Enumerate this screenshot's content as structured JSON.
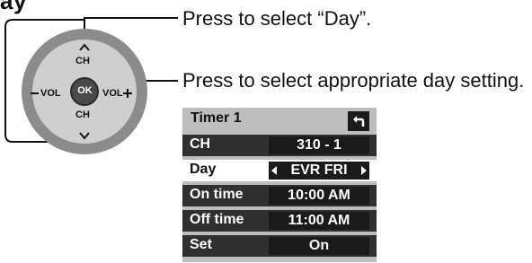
{
  "heading": "ay",
  "callouts": {
    "select_day": "Press to select “Day”.",
    "day_setting": "Press to select appropriate day setting."
  },
  "remote_pad": {
    "ch_up": "CH",
    "ch_down": "CH",
    "vol_minus": "VOL",
    "vol_plus": "VOL",
    "ok": "OK"
  },
  "menu": {
    "title": "Timer 1",
    "rows": [
      {
        "label": "CH",
        "value": "310 - 1"
      },
      {
        "label": "Day",
        "value": "EVR FRI",
        "selected": true
      },
      {
        "label": "On time",
        "value": "10:00 AM"
      },
      {
        "label": "Off time",
        "value": "11:00 AM"
      },
      {
        "label": "Set",
        "value": "On"
      }
    ]
  },
  "colors": {
    "pad_outer": "#8c8c8c",
    "pad_inner": "#c4c4c4",
    "menu_bg": "#bdbdbd",
    "row_bg": "#2f2f2f",
    "value_bg": "#1a1a1a"
  }
}
